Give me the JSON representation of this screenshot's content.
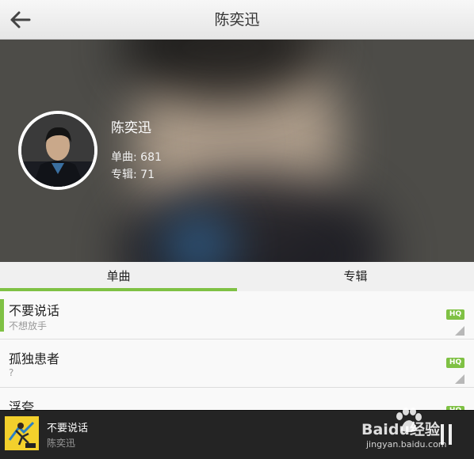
{
  "header": {
    "title": "陈奕迅"
  },
  "artist": {
    "name": "陈奕迅",
    "singles_label": "单曲: ",
    "singles_count": "681",
    "albums_label": "专辑: ",
    "albums_count": "71"
  },
  "tabs": [
    {
      "label": "单曲",
      "active": true
    },
    {
      "label": "专辑",
      "active": false
    }
  ],
  "songs": [
    {
      "title": "不要说话",
      "subtitle": "不想放手",
      "badge": "HQ"
    },
    {
      "title": "孤独患者",
      "subtitle": "?",
      "badge": "HQ"
    },
    {
      "title": "浮夸",
      "subtitle": "",
      "badge": "HQ"
    }
  ],
  "player": {
    "title": "不要说话",
    "artist": "陈奕迅"
  },
  "watermark": {
    "text": "Baidu经验",
    "url": "jingyan.baidu.com"
  },
  "colors": {
    "accent": "#7fc144",
    "player_bg": "#242424"
  }
}
